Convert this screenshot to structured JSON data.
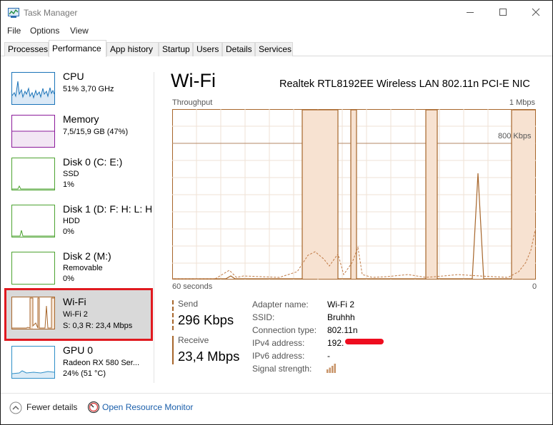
{
  "window": {
    "title": "Task Manager"
  },
  "menu": [
    "File",
    "Options",
    "View"
  ],
  "tabs": [
    "Processes",
    "Performance",
    "App history",
    "Startup",
    "Users",
    "Details",
    "Services"
  ],
  "active_tab": "Performance",
  "sidebar": {
    "items": [
      {
        "name": "CPU",
        "lines": [
          "51% 3,70 GHz"
        ],
        "color": "#1a73b8"
      },
      {
        "name": "Memory",
        "lines": [
          "7,5/15,9 GB (47%)"
        ],
        "color": "#8b1a9a"
      },
      {
        "name": "Disk 0 (C: E:)",
        "lines": [
          "SSD",
          "1%"
        ],
        "color": "#4da331"
      },
      {
        "name": "Disk 1 (D: F: H: L: H",
        "lines": [
          "HDD",
          "0%"
        ],
        "color": "#4da331"
      },
      {
        "name": "Disk 2 (M:)",
        "lines": [
          "Removable",
          "0%"
        ],
        "color": "#4da331"
      },
      {
        "name": "Wi-Fi",
        "lines": [
          "Wi-Fi 2",
          "S: 0,3  R: 23,4 Mbps"
        ],
        "color": "#a7662b"
      },
      {
        "name": "GPU 0",
        "lines": [
          "Radeon RX 580 Ser...",
          "24% (51 °C)"
        ],
        "color": "#2e8fc8"
      }
    ],
    "selected_index": 5
  },
  "main": {
    "title": "Wi-Fi",
    "adapter": "Realtek RTL8192EE Wireless LAN 802.11n PCI-E NIC",
    "chart_label_left": "Throughput",
    "chart_label_right": "1 Mbps",
    "chart_mid_label": "800 Kbps",
    "chart_bottom_left": "60 seconds",
    "chart_bottom_right": "0",
    "accent_color": "#a7662b"
  },
  "stats": {
    "send_label": "Send",
    "send_value": "296 Kbps",
    "receive_label": "Receive",
    "receive_value": "23,4 Mbps"
  },
  "properties": [
    {
      "key": "Adapter name:",
      "value": "Wi-Fi 2"
    },
    {
      "key": "SSID:",
      "value": "Bruhhh"
    },
    {
      "key": "Connection type:",
      "value": "802.11n"
    },
    {
      "key": "IPv4 address:",
      "value": "192."
    },
    {
      "key": "IPv6 address:",
      "value": "-"
    },
    {
      "key": "Signal strength:",
      "value": ""
    }
  ],
  "signal_icon": "signal-strength-icon",
  "bottom": {
    "fewer_details": "Fewer details",
    "resource_monitor": "Open Resource Monitor"
  }
}
